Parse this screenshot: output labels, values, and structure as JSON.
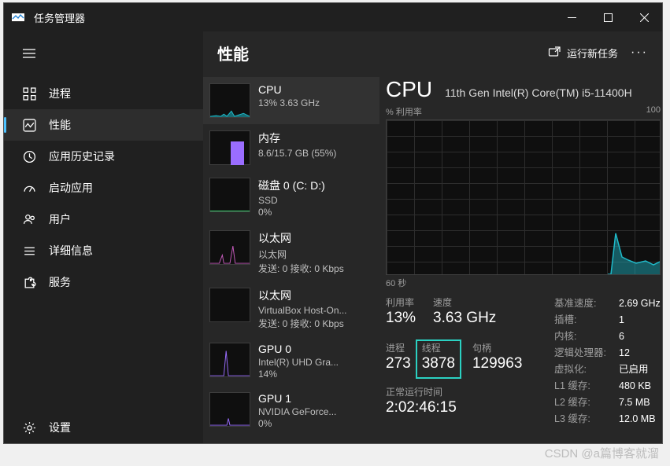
{
  "titlebar": {
    "title": "任务管理器"
  },
  "header": {
    "title": "性能",
    "new_task": "运行新任务",
    "more": "···"
  },
  "sidebar": {
    "items": [
      {
        "label": "进程"
      },
      {
        "label": "性能"
      },
      {
        "label": "应用历史记录"
      },
      {
        "label": "启动应用"
      },
      {
        "label": "用户"
      },
      {
        "label": "详细信息"
      },
      {
        "label": "服务"
      }
    ],
    "settings": "设置"
  },
  "list": {
    "items": [
      {
        "label": "CPU",
        "sub": "13% 3.63 GHz"
      },
      {
        "label": "内存",
        "sub": "8.6/15.7 GB (55%)"
      },
      {
        "label": "磁盘 0 (C: D:)",
        "sub": "SSD",
        "sub2": "0%"
      },
      {
        "label": "以太网",
        "sub": "以太网",
        "sub2": "发送: 0 接收: 0 Kbps"
      },
      {
        "label": "以太网",
        "sub": "VirtualBox Host-On...",
        "sub2": "发送: 0 接收: 0 Kbps"
      },
      {
        "label": "GPU 0",
        "sub": "Intel(R) UHD Gra...",
        "sub2": "14%"
      },
      {
        "label": "GPU 1",
        "sub": "NVIDIA GeForce...",
        "sub2": "0%"
      }
    ]
  },
  "detail": {
    "title": "CPU",
    "model": "11th Gen Intel(R) Core(TM) i5-11400H",
    "graph_top_left": "% 利用率",
    "graph_top_right": "100",
    "graph_bottom": "60 秒",
    "stats": {
      "util": {
        "label": "利用率",
        "value": "13%"
      },
      "speed": {
        "label": "速度",
        "value": "3.63 GHz"
      },
      "proc": {
        "label": "进程",
        "value": "273"
      },
      "threads": {
        "label": "线程",
        "value": "3878"
      },
      "handles": {
        "label": "句柄",
        "value": "129963"
      },
      "uptime": {
        "label": "正常运行时间",
        "value": "2:02:46:15"
      }
    },
    "specs": {
      "base": {
        "k": "基准速度:",
        "v": "2.69 GHz"
      },
      "sockets": {
        "k": "插槽:",
        "v": "1"
      },
      "cores": {
        "k": "内核:",
        "v": "6"
      },
      "lps": {
        "k": "逻辑处理器:",
        "v": "12"
      },
      "virt": {
        "k": "虚拟化:",
        "v": "已启用"
      },
      "l1": {
        "k": "L1 缓存:",
        "v": "480 KB"
      },
      "l2": {
        "k": "L2 缓存:",
        "v": "7.5 MB"
      },
      "l3": {
        "k": "L3 缓存:",
        "v": "12.0 MB"
      }
    }
  },
  "watermark": "CSDN @a篇博客就溜"
}
